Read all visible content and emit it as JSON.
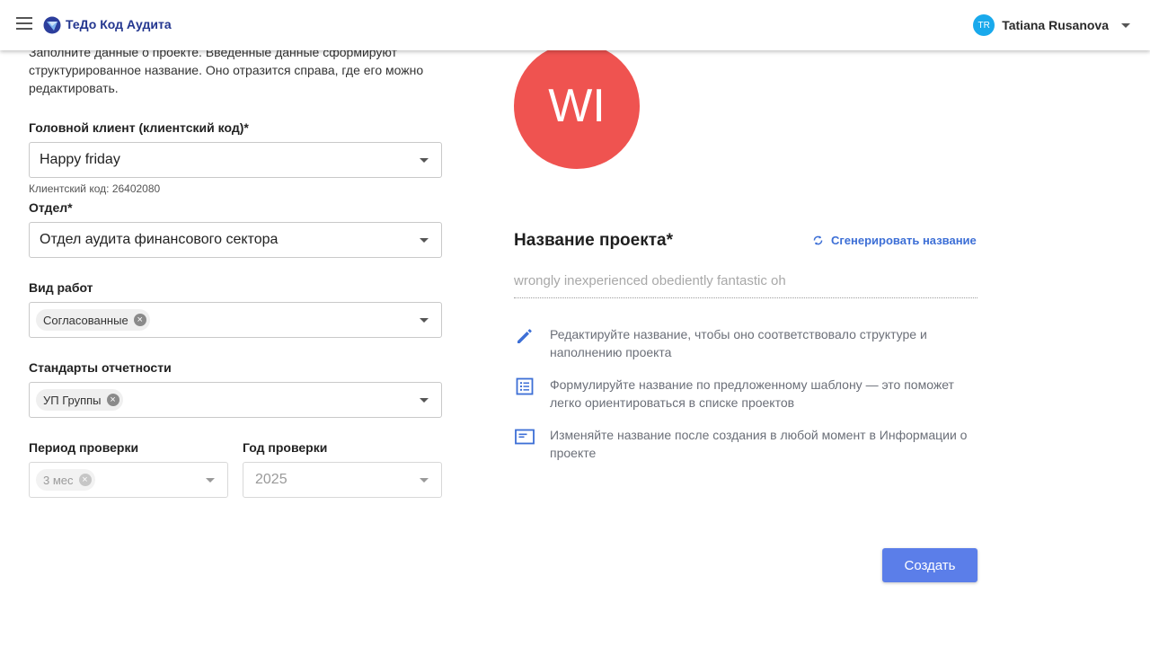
{
  "app": {
    "brand": "ТеДо Код Аудита"
  },
  "user": {
    "initials": "TR",
    "name": "Tatiana Rusanova"
  },
  "form": {
    "intro": "Заполните данные о проекте. Введенные данные сформируют структурированное название. Оно отразится справа, где его можно редактировать.",
    "client": {
      "label": "Головной клиент (клиентский код)*",
      "value": "Happy friday",
      "hint": "Клиентский код: 26402080"
    },
    "department": {
      "label": "Отдел*",
      "value": "Отдел аудита финансового сектора"
    },
    "work_type": {
      "label": "Вид работ",
      "chip": "Согласованные"
    },
    "standards": {
      "label": "Стандарты отчетности",
      "chip": "УП Группы"
    },
    "period": {
      "label": "Период проверки",
      "chip": "3 мес"
    },
    "year": {
      "label": "Год проверки",
      "value": "2025"
    }
  },
  "project": {
    "avatar": "WI",
    "title": "Название проекта*",
    "generate": "Сгенерировать название",
    "name": "wrongly inexperienced obediently fantastic oh",
    "tips": [
      "Редактируйте название, чтобы оно соответствовало структуре и наполнению проекта",
      "Формулируйте название по предложенному шаблону — это поможет легко ориентироваться в списке проектов",
      "Изменяйте название после создания в любой момент в Информации о проекте"
    ],
    "create": "Создать"
  },
  "colors": {
    "accent": "#5b7ee9",
    "avatar": "#ef5350",
    "brand": "#23368f",
    "link": "#3d6fd6"
  }
}
